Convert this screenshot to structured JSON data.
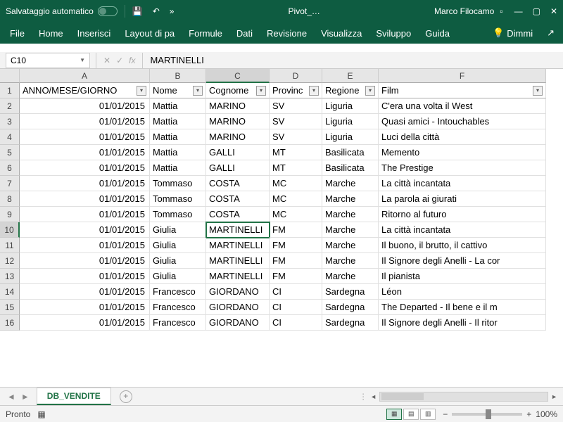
{
  "titlebar": {
    "autosave": "Salvataggio automatico",
    "docname": "Pivot_…",
    "username": "Marco Filocamo"
  },
  "ribbon": {
    "tabs": [
      "File",
      "Home",
      "Inserisci",
      "Layout di pa",
      "Formule",
      "Dati",
      "Revisione",
      "Visualizza",
      "Sviluppo",
      "Guida"
    ],
    "tellme": "Dimmi"
  },
  "fx": {
    "cellref": "C10",
    "value": "MARTINELLI"
  },
  "columns": [
    "A",
    "B",
    "C",
    "D",
    "E",
    "F"
  ],
  "headers": [
    "ANNO/MESE/GIORNO",
    "Nome",
    "Cognome",
    "Provinc",
    "Regione",
    "Film"
  ],
  "selected_row": 10,
  "selected_col": 2,
  "rows": [
    {
      "n": 2,
      "d": [
        "01/01/2015",
        "Mattia",
        "MARINO",
        "SV",
        "Liguria",
        "C'era una volta il West"
      ]
    },
    {
      "n": 3,
      "d": [
        "01/01/2015",
        "Mattia",
        "MARINO",
        "SV",
        "Liguria",
        "Quasi amici - Intouchables"
      ]
    },
    {
      "n": 4,
      "d": [
        "01/01/2015",
        "Mattia",
        "MARINO",
        "SV",
        "Liguria",
        "Luci della città"
      ]
    },
    {
      "n": 5,
      "d": [
        "01/01/2015",
        "Mattia",
        "GALLI",
        "MT",
        "Basilicata",
        "Memento"
      ]
    },
    {
      "n": 6,
      "d": [
        "01/01/2015",
        "Mattia",
        "GALLI",
        "MT",
        "Basilicata",
        "The Prestige"
      ]
    },
    {
      "n": 7,
      "d": [
        "01/01/2015",
        "Tommaso",
        "COSTA",
        "MC",
        "Marche",
        "La città incantata"
      ]
    },
    {
      "n": 8,
      "d": [
        "01/01/2015",
        "Tommaso",
        "COSTA",
        "MC",
        "Marche",
        "La parola ai giurati"
      ]
    },
    {
      "n": 9,
      "d": [
        "01/01/2015",
        "Tommaso",
        "COSTA",
        "MC",
        "Marche",
        "Ritorno al futuro"
      ]
    },
    {
      "n": 10,
      "d": [
        "01/01/2015",
        "Giulia",
        "MARTINELLI",
        "FM",
        "Marche",
        "La città incantata"
      ]
    },
    {
      "n": 11,
      "d": [
        "01/01/2015",
        "Giulia",
        "MARTINELLI",
        "FM",
        "Marche",
        "Il buono, il brutto, il cattivo"
      ]
    },
    {
      "n": 12,
      "d": [
        "01/01/2015",
        "Giulia",
        "MARTINELLI",
        "FM",
        "Marche",
        "Il Signore degli Anelli - La cor"
      ]
    },
    {
      "n": 13,
      "d": [
        "01/01/2015",
        "Giulia",
        "MARTINELLI",
        "FM",
        "Marche",
        "Il pianista"
      ]
    },
    {
      "n": 14,
      "d": [
        "01/01/2015",
        "Francesco",
        "GIORDANO",
        "CI",
        "Sardegna",
        "Léon"
      ]
    },
    {
      "n": 15,
      "d": [
        "01/01/2015",
        "Francesco",
        "GIORDANO",
        "CI",
        "Sardegna",
        "The Departed - Il bene e il m"
      ]
    },
    {
      "n": 16,
      "d": [
        "01/01/2015",
        "Francesco",
        "GIORDANO",
        "CI",
        "Sardegna",
        "Il Signore degli Anelli - Il ritor"
      ]
    }
  ],
  "sheet": {
    "name": "DB_VENDITE"
  },
  "status": {
    "ready": "Pronto",
    "zoom": "100%"
  }
}
